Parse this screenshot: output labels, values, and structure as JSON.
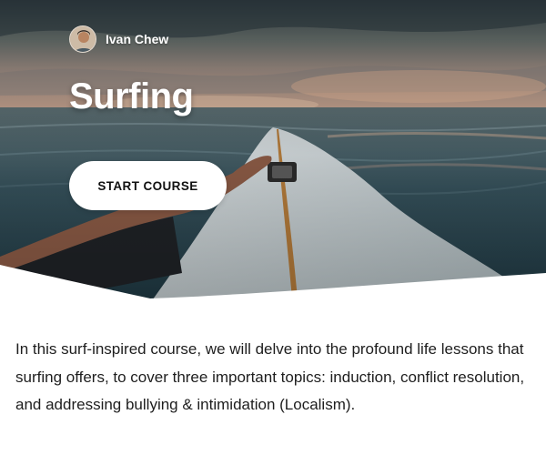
{
  "hero": {
    "image": "surfboard-ocean-sunset",
    "author": {
      "name": "Ivan Chew",
      "avatar": "author-avatar"
    },
    "title": "Surfing",
    "cta_label": "START COURSE"
  },
  "description": "In this surf-inspired course, we will delve into the profound life lessons that surfing offers, to cover three important topics: induction, conflict resolution, and addressing bullying & intimidation (Localism).",
  "colors": {
    "page_background": "#ffffff",
    "button_background": "#ffffff",
    "button_text": "#111111",
    "body_text": "#1e1e1e",
    "hero_text": "#ffffff"
  }
}
